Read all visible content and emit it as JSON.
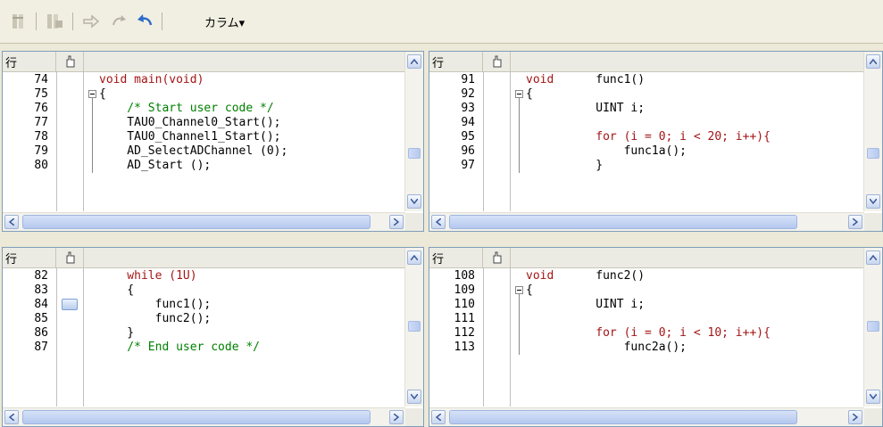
{
  "toolbar": {
    "buttons": [
      {
        "icon": "go-to-call-stack-icon"
      },
      {
        "icon": "go-to-current-icon"
      },
      {
        "icon": "step-over-arrow-icon"
      },
      {
        "icon": "redo-arrow-icon"
      },
      {
        "icon": "undo-arrow-icon"
      }
    ],
    "column_menu_label": "カラム▾"
  },
  "headers": {
    "line_label": "行",
    "breakpoint_icon": "pointing-hand-icon"
  },
  "colors": {
    "keyword": "#a31515",
    "comment": "#008000",
    "scroll_accent": "#9fb3d6"
  },
  "panes": [
    {
      "lines": [
        {
          "n": "74",
          "code": [
            {
              "t": "void main(void)",
              "c": "kw"
            }
          ]
        },
        {
          "n": "75",
          "fold": true,
          "code": [
            {
              "t": "{",
              "c": "cd"
            }
          ]
        },
        {
          "n": "76",
          "code": [
            {
              "t": "    /* Start user code */",
              "c": "cm"
            }
          ]
        },
        {
          "n": "77",
          "code": [
            {
              "t": "    TAU0_Channel0_Start();",
              "c": "cd"
            }
          ]
        },
        {
          "n": "78",
          "code": [
            {
              "t": "    TAU0_Channel1_Start();",
              "c": "cd"
            }
          ]
        },
        {
          "n": "79",
          "code": [
            {
              "t": "    AD_SelectADChannel (0);",
              "c": "cd"
            }
          ]
        },
        {
          "n": "80",
          "code": [
            {
              "t": "    AD_Start ();",
              "c": "cd"
            }
          ]
        }
      ]
    },
    {
      "lines": [
        {
          "n": "91",
          "code": [
            {
              "t": "void",
              "c": "kw"
            },
            {
              "t": "      func1()",
              "c": "cd"
            }
          ]
        },
        {
          "n": "92",
          "fold": true,
          "code": [
            {
              "t": "{",
              "c": "cd"
            }
          ]
        },
        {
          "n": "93",
          "code": [
            {
              "t": "          UINT i;",
              "c": "cd"
            }
          ]
        },
        {
          "n": "94",
          "code": []
        },
        {
          "n": "95",
          "code": [
            {
              "t": "          for (i = 0; i < 20; i++){",
              "c": "kw"
            }
          ]
        },
        {
          "n": "96",
          "code": [
            {
              "t": "              func1a();",
              "c": "cd"
            }
          ]
        },
        {
          "n": "97",
          "code": [
            {
              "t": "          }",
              "c": "cd"
            }
          ]
        }
      ]
    },
    {
      "lines": [
        {
          "n": "82",
          "code": [
            {
              "t": "    while (1U)",
              "c": "kw"
            }
          ]
        },
        {
          "n": "83",
          "code": [
            {
              "t": "    {",
              "c": "cd"
            }
          ]
        },
        {
          "n": "84",
          "bp": true,
          "code": [
            {
              "t": "        func1();",
              "c": "cd"
            }
          ]
        },
        {
          "n": "85",
          "code": [
            {
              "t": "        func2();",
              "c": "cd"
            }
          ]
        },
        {
          "n": "86",
          "code": [
            {
              "t": "    }",
              "c": "cd"
            }
          ]
        },
        {
          "n": "87",
          "code": [
            {
              "t": "    /* End user code */",
              "c": "cm"
            }
          ]
        }
      ]
    },
    {
      "lines": [
        {
          "n": "108",
          "code": [
            {
              "t": "void",
              "c": "kw"
            },
            {
              "t": "      func2()",
              "c": "cd"
            }
          ]
        },
        {
          "n": "109",
          "fold": true,
          "code": [
            {
              "t": "{",
              "c": "cd"
            }
          ]
        },
        {
          "n": "110",
          "code": [
            {
              "t": "          UINT i;",
              "c": "cd"
            }
          ]
        },
        {
          "n": "111",
          "code": []
        },
        {
          "n": "112",
          "code": [
            {
              "t": "          for (i = 0; i < 10; i++){",
              "c": "kw"
            }
          ]
        },
        {
          "n": "113",
          "code": [
            {
              "t": "              func2a();",
              "c": "cd"
            }
          ]
        }
      ]
    }
  ]
}
